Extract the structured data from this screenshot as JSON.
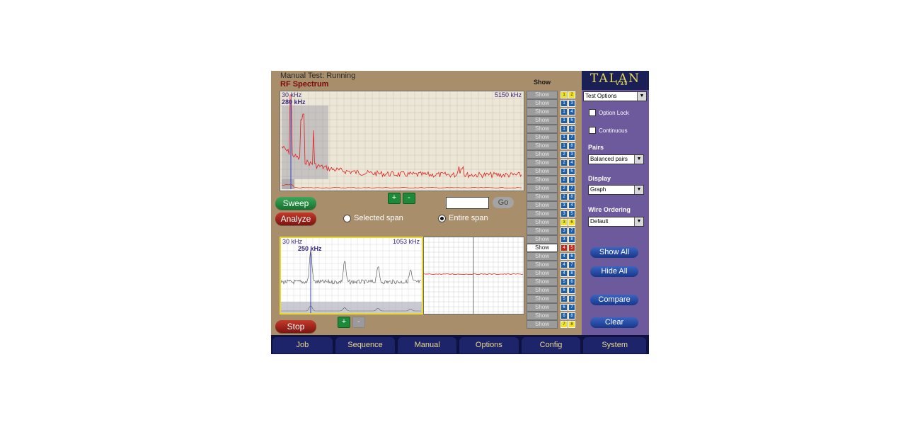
{
  "status": {
    "label": "Manual Test: Running"
  },
  "title": "RF Spectrum",
  "spectrum_top": {
    "start": "30 kHz",
    "end": "5150 kHz",
    "marker": "280 kHz"
  },
  "spectrum_bottom": {
    "start": "30 kHz",
    "end": "1053 kHz",
    "marker": "250 kHz"
  },
  "buttons": {
    "sweep": "Sweep",
    "analyze": "Analyze",
    "stop": "Stop",
    "go": "Go",
    "plus": "+",
    "minus": "-"
  },
  "span": {
    "selected": "Selected span",
    "entire": "Entire span",
    "selected_option": "entire"
  },
  "pairs": {
    "header": "Show",
    "show_label": "Show",
    "rows": [
      {
        "a": "1",
        "b": "2",
        "color": "yellow",
        "active": false
      },
      {
        "a": "1",
        "b": "3",
        "color": "blue",
        "active": false
      },
      {
        "a": "1",
        "b": "4",
        "color": "blue",
        "active": false
      },
      {
        "a": "1",
        "b": "5",
        "color": "blue",
        "active": false
      },
      {
        "a": "1",
        "b": "6",
        "color": "blue",
        "active": false
      },
      {
        "a": "1",
        "b": "7",
        "color": "blue",
        "active": false
      },
      {
        "a": "1",
        "b": "8",
        "color": "blue",
        "active": false
      },
      {
        "a": "2",
        "b": "3",
        "color": "blue",
        "active": false
      },
      {
        "a": "2",
        "b": "4",
        "color": "blue",
        "active": false
      },
      {
        "a": "2",
        "b": "5",
        "color": "blue",
        "active": false
      },
      {
        "a": "2",
        "b": "6",
        "color": "blue",
        "active": false
      },
      {
        "a": "2",
        "b": "7",
        "color": "blue",
        "active": false
      },
      {
        "a": "2",
        "b": "8",
        "color": "blue",
        "active": false
      },
      {
        "a": "3",
        "b": "4",
        "color": "blue",
        "active": false
      },
      {
        "a": "3",
        "b": "5",
        "color": "blue",
        "active": false
      },
      {
        "a": "3",
        "b": "6",
        "color": "yellow",
        "active": false
      },
      {
        "a": "3",
        "b": "7",
        "color": "blue",
        "active": false
      },
      {
        "a": "3",
        "b": "8",
        "color": "blue",
        "active": false
      },
      {
        "a": "4",
        "b": "5",
        "color": "red",
        "active": true
      },
      {
        "a": "4",
        "b": "6",
        "color": "blue",
        "active": false
      },
      {
        "a": "4",
        "b": "7",
        "color": "blue",
        "active": false
      },
      {
        "a": "4",
        "b": "8",
        "color": "blue",
        "active": false
      },
      {
        "a": "5",
        "b": "6",
        "color": "blue",
        "active": false
      },
      {
        "a": "5",
        "b": "7",
        "color": "blue",
        "active": false
      },
      {
        "a": "5",
        "b": "8",
        "color": "blue",
        "active": false
      },
      {
        "a": "6",
        "b": "7",
        "color": "blue",
        "active": false
      },
      {
        "a": "6",
        "b": "8",
        "color": "blue",
        "active": false
      },
      {
        "a": "7",
        "b": "8",
        "color": "yellow",
        "active": false
      }
    ]
  },
  "panel": {
    "logo": "TALAN",
    "version": "V 3.0",
    "test_options": "Test Options",
    "option_lock": "Option Lock",
    "continuous": "Continuous",
    "pairs_label": "Pairs",
    "pairs_value": "Balanced pairs",
    "display_label": "Display",
    "display_value": "Graph",
    "wire_label": "Wire Ordering",
    "wire_value": "Default",
    "show_all": "Show All",
    "hide_all": "Hide All",
    "compare": "Compare",
    "clear": "Clear"
  },
  "nav": [
    {
      "label": "Job"
    },
    {
      "label": "Sequence"
    },
    {
      "label": "Manual"
    },
    {
      "label": "Options"
    },
    {
      "label": "Config"
    },
    {
      "label": "System"
    }
  ],
  "colors": {
    "trace_red": "#e02020",
    "trace_gray": "#606060",
    "marker_blue": "#3040c0",
    "panel": "#6c5a9c",
    "nav": "#1e246a"
  }
}
